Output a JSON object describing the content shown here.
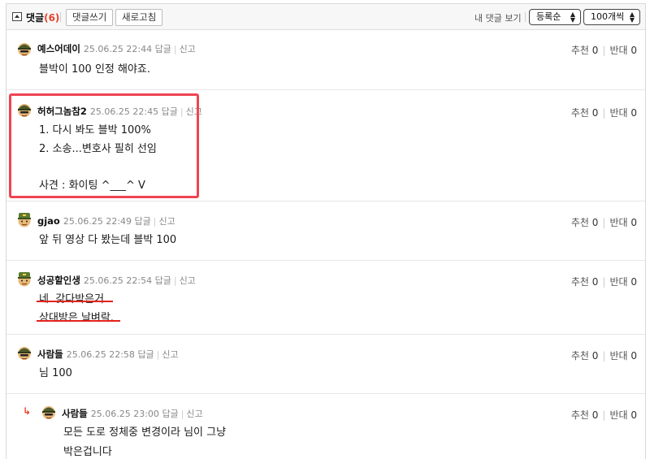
{
  "toolbar": {
    "title": "댓글",
    "count": "(6)",
    "write_button": "댓글쓰기",
    "refresh_button": "새로고침",
    "my_comments": "내 댓글 보기",
    "sort_select": "등록순",
    "per_page_select": "100개씩"
  },
  "labels": {
    "reply": "답글",
    "report": "신고",
    "recommend": "추천",
    "oppose": "반대"
  },
  "colors": {
    "highlight": "#ef4452",
    "count": "#e8432b",
    "underline": "#e2231a"
  },
  "comments": [
    {
      "nick": "예스어데이",
      "time": "25.06.25 22:44",
      "text": "블박이 100 인정 해야죠.",
      "rec": "0",
      "opp": "0",
      "avatar": "helmet-avatar-icon"
    },
    {
      "nick": "허허그놈참2",
      "time": "25.06.25 22:45",
      "text": "1. 다시 봐도 블박 100%\n2. 소송...변호사 필히 선임\n\n사견 : 화이팅 ^___^ V",
      "rec": "0",
      "opp": "0",
      "avatar": "helmet-avatar-icon"
    },
    {
      "nick": "gjao",
      "time": "25.06.25 22:49",
      "text": "앞 뒤 영상 다 봤는데 블박 100",
      "rec": "0",
      "opp": "0",
      "avatar": "soldier-avatar-icon"
    },
    {
      "nick": "성공할인생",
      "time": "25.06.25 22:54",
      "text": "네 .갖다박은거.\n상대방은 날벼락.",
      "rec": "0",
      "opp": "0",
      "avatar": "soldier-avatar-icon"
    },
    {
      "nick": "사람들",
      "time": "25.06.25 22:58",
      "text": "님 100",
      "rec": "0",
      "opp": "0",
      "avatar": "helmet-avatar-icon"
    },
    {
      "nick": "사람들",
      "time": "25.06.25 23:00",
      "text": "모든 도로 정체중 변경이라 님이 그냥\n박은겁니다",
      "rec": "0",
      "opp": "0",
      "avatar": "helmet-avatar-icon",
      "is_reply": true
    }
  ]
}
